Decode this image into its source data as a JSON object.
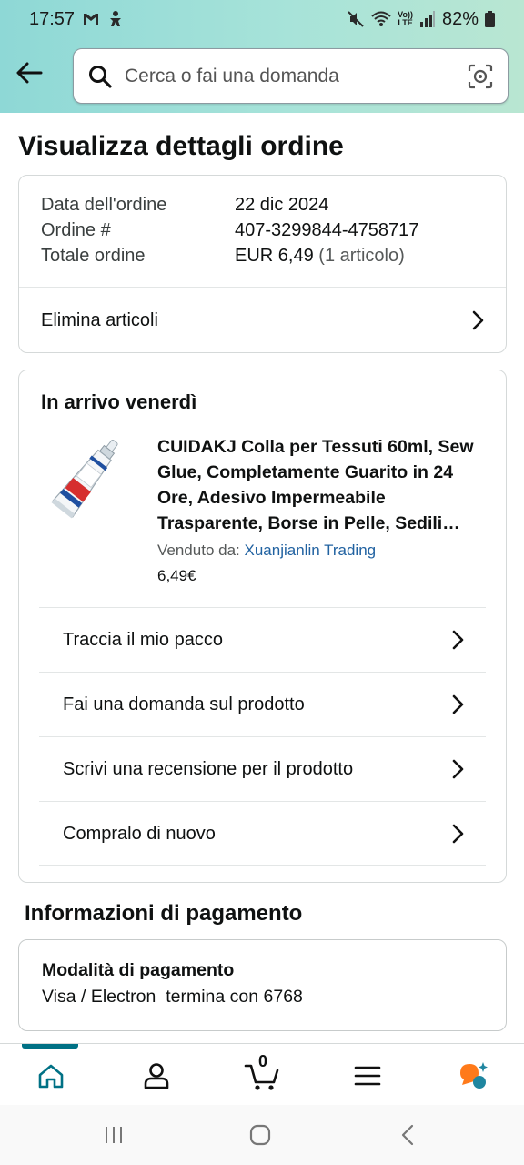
{
  "status_bar": {
    "time": "17:57",
    "battery": "82%",
    "network_label": "LTE",
    "network_top": "Vo))"
  },
  "search": {
    "placeholder": "Cerca o fai una domanda"
  },
  "page_title": "Visualizza dettagli ordine",
  "order_summary": {
    "date_label": "Data dell'ordine",
    "date_value": "22 dic 2024",
    "order_label": "Ordine #",
    "order_value": "407-3299844-4758717",
    "total_label": "Totale ordine",
    "total_value": "EUR 6,49",
    "total_items": "(1 articolo)",
    "delete_items_label": "Elimina articoli"
  },
  "shipment": {
    "arrival": "In arrivo venerdì",
    "product_title": "CUIDAKJ Colla per Tessuti 60ml, Sew Glue, Completamente Guarito in 24 Ore, Adesivo Impermeabile Trasparente, Borse in Pelle, Sedili…",
    "sold_by_label": "Venduto da:",
    "seller_name": "Xuanjianlin Trading",
    "price": "6,49€",
    "actions": [
      {
        "label": "Traccia il mio pacco"
      },
      {
        "label": "Fai una domanda sul prodotto"
      },
      {
        "label": "Scrivi una recensione per il prodotto"
      },
      {
        "label": "Compralo di nuovo"
      }
    ]
  },
  "payment": {
    "section_title": "Informazioni di pagamento",
    "method_label": "Modalità di pagamento",
    "method_value": "Visa / Electron  termina con 6768"
  },
  "bottom_nav": {
    "cart_count": "0",
    "active": "home",
    "accent_color": "#007185"
  },
  "icons": [
    "back-arrow-icon",
    "search-icon",
    "camera-lens-icon",
    "chevron-right-icon",
    "home-icon",
    "profile-icon",
    "cart-icon",
    "menu-icon",
    "assistant-icon"
  ]
}
